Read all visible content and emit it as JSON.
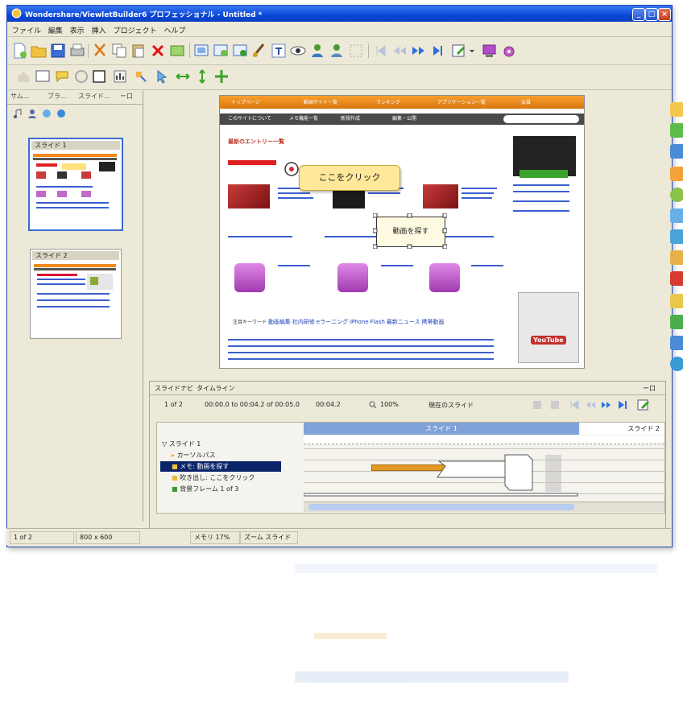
{
  "window": {
    "title": "Wondershare/ViewletBuilder6 プロフェッショナル - Untitled *"
  },
  "menu": [
    "ファイル",
    "編集",
    "表示",
    "挿入",
    "プロジェクト",
    "ヘルプ"
  ],
  "left_panel": {
    "tabs": [
      "サム...",
      "ブラ...",
      "スライド...",
      "ー口"
    ],
    "slides": [
      {
        "label": "スライド 1"
      },
      {
        "label": "スライド 2"
      }
    ]
  },
  "slide": {
    "web_nav": [
      "トップページ",
      "動画サイト一覧",
      "ランキング",
      "アプリケーション一覧",
      "会員"
    ],
    "web_subnav": [
      "このサイトについて",
      "メモ機能一覧",
      "新規作成",
      "編集・公開"
    ],
    "section_heading": "最新のエントリー一覧",
    "bubble_click": "ここをクリック",
    "bubble_find": "動画を探す",
    "tag_row": "注目キーワード",
    "tag_list": [
      "動画編集",
      "社内研修",
      "eラーニング",
      "iPhone",
      "Flash",
      "最新ニュース",
      "携帯動画"
    ],
    "youtube_label": "YouTube"
  },
  "timeline": {
    "tabs": [
      "スライドナビ",
      "タイムライン"
    ],
    "counter": "1 of 2",
    "timecode": "00:00.0 to 00:04.2 of 00:05.0",
    "duration": "00:04.2",
    "zoom": "100%",
    "prev_slide_label": "現在のスライド",
    "slide_header_1": "スライド 1",
    "slide_header_2": "スライド 2",
    "tree_root": "スライド 1",
    "rows": [
      {
        "label": "カーソルパス"
      },
      {
        "label": "メモ: 動画を探す",
        "selected": true
      },
      {
        "label": "吹き出し: ここをクリック"
      },
      {
        "label": "背景フレーム 1 of 3"
      }
    ]
  },
  "status": {
    "page": "1 of 2",
    "size": "800 x 600",
    "memo": "メモリ 17%",
    "zoom": "ズーム スライド"
  },
  "colors": {
    "titlebar": "#0a48d8",
    "selection": "#0a246a",
    "timeline_header": "#7fa2d8",
    "orange_bar": "#e19a26",
    "bubble": "#ffe89a"
  }
}
